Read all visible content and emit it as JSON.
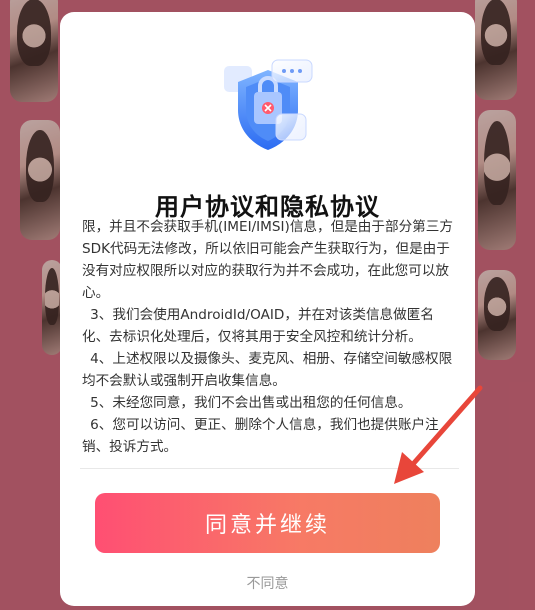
{
  "dialog": {
    "title": "用户协议和隐私协议",
    "paragraphs": [
      "限，并且不会获取手机(IMEI/IMSI)信息，但是由于部分第三方SDK代码无法修改，所以依旧可能会产生获取行为，但是由于没有对应权限所以对应的获取行为并不会成功，在此您可以放心。",
      "3、我们会使用AndroidId/OAID，并在对该类信息做匿名化、去标识化处理后，仅将其用于安全风控和统计分析。",
      "4、上述权限以及摄像头、麦克风、相册、存储空间敏感权限均不会默认或强制开启收集信息。",
      "5、未经您同意，我们不会出售或出租您的任何信息。",
      "6、您可以访问、更正、删除个人信息，我们也提供账户注销、投诉方式。"
    ],
    "agree_label": "同意并继续",
    "decline_label": "不同意"
  },
  "colors": {
    "agree_gradient_start": "#ff4f73",
    "agree_gradient_end": "#ee805d",
    "arrow": "#e8463a",
    "background_accent": "#d2687c"
  },
  "icons": {
    "header": "shield-icon",
    "pointer": "arrow-icon"
  }
}
